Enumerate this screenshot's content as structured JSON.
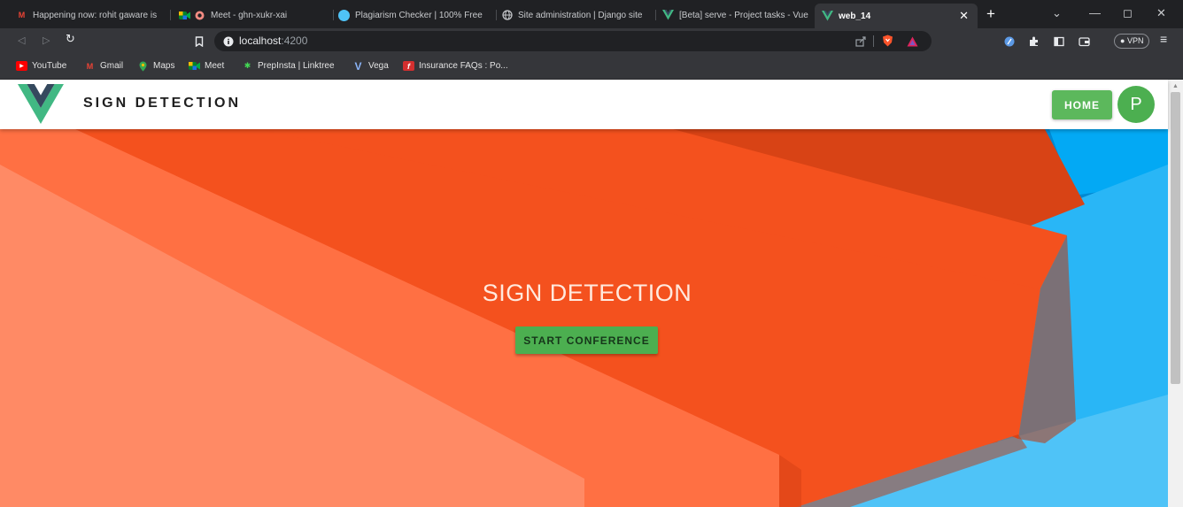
{
  "tabs": [
    {
      "title": "Happening now: rohit gaware is",
      "favicon": "gmail-icon"
    },
    {
      "title": "Meet - ghn-xukr-xai",
      "favicon": "meet-icon"
    },
    {
      "title": "Plagiarism Checker | 100% Free",
      "favicon": "plagiarism-icon"
    },
    {
      "title": "Site administration | Django site",
      "favicon": "globe-icon"
    },
    {
      "title": "[Beta] serve - Project tasks - Vue",
      "favicon": "vue-icon"
    },
    {
      "title": "web_14",
      "favicon": "vue-icon",
      "active": true
    }
  ],
  "address_bar": {
    "host": "localhost",
    "port": ":4200"
  },
  "vpn_label": "VPN",
  "bookmarks": [
    {
      "label": "YouTube",
      "icon": "youtube-icon"
    },
    {
      "label": "Gmail",
      "icon": "gmail-icon"
    },
    {
      "label": "Maps",
      "icon": "maps-icon"
    },
    {
      "label": "Meet",
      "icon": "meet-icon"
    },
    {
      "label": "PrepInsta | Linktree",
      "icon": "linktree-icon"
    },
    {
      "label": "Vega",
      "icon": "vega-icon"
    },
    {
      "label": "Insurance FAQs : Po...",
      "icon": "insurance-icon"
    }
  ],
  "app": {
    "brand": "SIGN DETECTION",
    "home_label": "HOME",
    "avatar_initial": "P"
  },
  "hero": {
    "title": "SIGN DETECTION",
    "cta_label": "START CONFERENCE"
  },
  "colors": {
    "home_button": "#5cb85c",
    "cta_button": "#4caf50",
    "avatar": "#4caf50",
    "hero_orange": "#f4511e",
    "hero_blue": "#29b6f6"
  }
}
